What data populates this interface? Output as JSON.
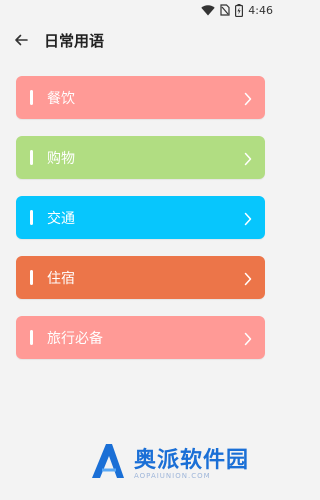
{
  "status_bar": {
    "time": "4:46",
    "icons": [
      "wifi-icon",
      "no-sim-icon",
      "battery-icon"
    ]
  },
  "header": {
    "back_icon": "arrow-left-icon",
    "title": "日常用语"
  },
  "categories": [
    {
      "label": "餐饮",
      "color": "#ff9a96"
    },
    {
      "label": "购物",
      "color": "#b1dd82"
    },
    {
      "label": "交通",
      "color": "#07c6fd"
    },
    {
      "label": "住宿",
      "color": "#ec7549"
    },
    {
      "label": "旅行必备",
      "color": "#ff9a96"
    }
  ],
  "watermark": {
    "name": "奥派软件园",
    "url": "AOPAIUNION.COM",
    "color": "#1a6fd6"
  }
}
